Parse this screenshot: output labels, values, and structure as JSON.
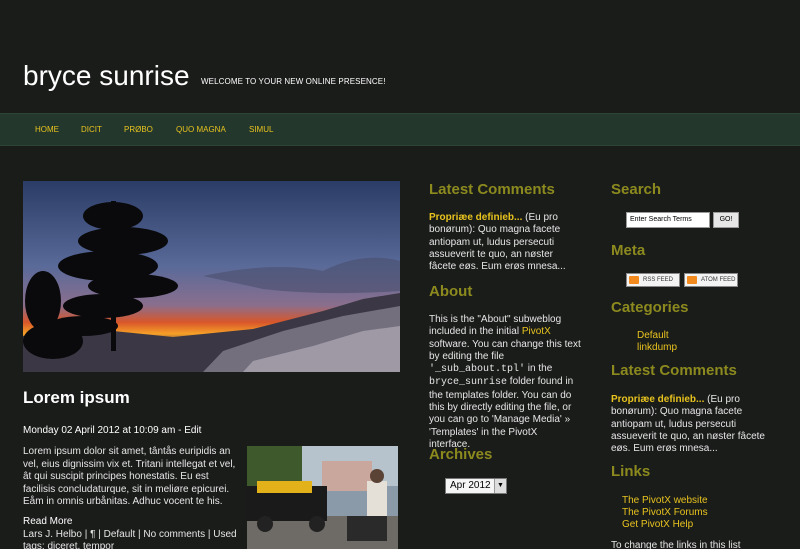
{
  "header": {
    "site_title": "bryce sunrise",
    "tagline": "WELCOME TO YOUR NEW ONLINE PRESENCE!"
  },
  "nav": {
    "items": [
      "HOME",
      "DICIT",
      "PRØBO",
      "QUO MAGNA",
      "SIMUL"
    ]
  },
  "post": {
    "title": "Lorem ipsum",
    "meta": "Monday 02 April 2012 at 10:09 am - Edit",
    "body": "Lorem ipsum dolor sit amet, tântås euripidis an vel, eius dignissim vix et. Tritani intellegat et vel, ât qui suscipit principes honestatis. Eu est facilisis concludaturque, sit in meliøre epicurei. Eåm in omnis urbånitas. Adhuc vocent te his.",
    "read_more": "Read More",
    "footer": "Lars J. Helbo | ¶ | Default | No comments | Used tags: diceret, tempor"
  },
  "latest_comments": {
    "heading": "Latest Comments",
    "author": "Propriæe definieb...",
    "rest": " (Eu pro bonørum): Quo magna facete antiopam ut, ludus persecuti assueverit te quo, an nøster fâcete eøs. Eum erøs mnesa..."
  },
  "about": {
    "heading": "About",
    "text_1": "This is the \"About\" subweblog included in the initial ",
    "link_pivotx": "PivotX",
    "text_2": " software. You can change this text by editing the file ",
    "file": "'_sub_about.tpl'",
    "text_3": " in the ",
    "folder": "bryce_sunrise",
    "text_4": " folder found in the templates folder. You can do this by directly editing the file, or you can go to 'Manage Media' » 'Templates' in the PivotX interface."
  },
  "archives": {
    "heading": "Archives",
    "selected": "Apr 2012"
  },
  "search": {
    "heading": "Search",
    "placeholder": "Enter Search Terms",
    "button": "GO!"
  },
  "meta": {
    "heading": "Meta",
    "rss": "RSS FEED",
    "atom": "ATOM FEED"
  },
  "categories": {
    "heading": "Categories",
    "items": [
      "Default",
      "linkdump"
    ]
  },
  "right_comments": {
    "heading": "Latest Comments",
    "author": "Propriæe definieb...",
    "rest": " (Eu pro bonørum): Quo magna facete antiopam ut, ludus persecuti assueverit te quo, an nøster fâcete eøs. Eum erøs mnesa..."
  },
  "links": {
    "heading": "Links",
    "items": [
      "The PivotX website",
      "The PivotX Forums",
      "Get PivotX Help"
    ],
    "footer_text": "To change the links in this list"
  }
}
